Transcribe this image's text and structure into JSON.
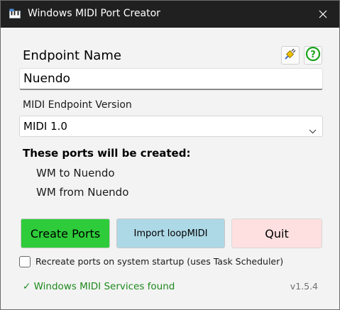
{
  "window": {
    "title": "Windows MIDI Port Creator",
    "close_glyph": "✕"
  },
  "endpoint": {
    "label": "Endpoint Name",
    "value": "Nuendo"
  },
  "icons": {
    "app": "midi-keyboard-icon",
    "plug": "plug-icon",
    "help": "help-icon",
    "close": "close-icon",
    "chevron": "chevron-down-icon"
  },
  "version_select": {
    "label": "MIDI Endpoint Version",
    "selected": "MIDI 1.0"
  },
  "ports": {
    "heading": "These ports will be created:",
    "items": [
      "WM to Nuendo",
      "WM from Nuendo"
    ]
  },
  "buttons": {
    "create": "Create Ports",
    "import": "Import loopMIDI",
    "quit": "Quit"
  },
  "startup_checkbox": {
    "label": "Recreate ports on system startup (uses Task Scheduler)",
    "checked": false
  },
  "status": {
    "text": "✓ Windows MIDI Services found",
    "version": "v1.5.4"
  },
  "colors": {
    "create_button": "#2ecc3a",
    "import_button": "#add8e6",
    "quit_button": "#ffe0e0",
    "status_green": "#1e8a1e",
    "titlebar": "#202020"
  }
}
